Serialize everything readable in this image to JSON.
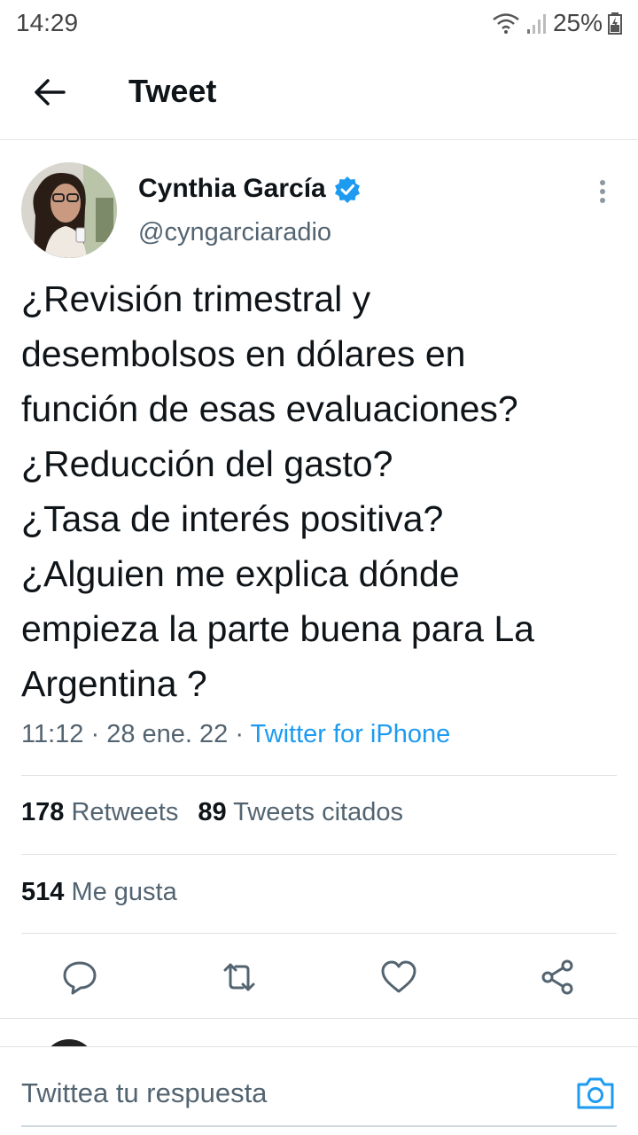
{
  "status_bar": {
    "time": "14:29",
    "battery": "25%",
    "icons": [
      "wifi-icon",
      "signal-icon",
      "battery-charging-icon"
    ]
  },
  "header": {
    "title": "Tweet",
    "back_icon": "arrow-left-icon"
  },
  "tweet": {
    "author_name": "Cynthia García",
    "author_handle": "@cyngarciaradio",
    "verified": true,
    "text": "¿Revisión trimestral y\ndesembolsos en dólares en\nfunción de esas evaluaciones?\n¿Reducción del gasto?\n¿Tasa de interés positiva?\n¿Alguien me explica dónde\nempieza la parte buena para La\nArgentina ?",
    "time": "11:12",
    "date": "28 ene. 22",
    "source": "Twitter for iPhone"
  },
  "stats": {
    "retweets_count": "178",
    "retweets_label": "Retweets",
    "quotes_count": "89",
    "quotes_label": "Tweets citados",
    "likes_count": "514",
    "likes_label": "Me gusta"
  },
  "actions": [
    "reply-icon",
    "retweet-icon",
    "like-icon",
    "share-icon"
  ],
  "reply_bar": {
    "placeholder": "Twittea tu respuesta",
    "camera_icon": "camera-icon"
  },
  "colors": {
    "accent": "#1d9bf0",
    "text": "#0f1419",
    "secondary": "#536471"
  }
}
